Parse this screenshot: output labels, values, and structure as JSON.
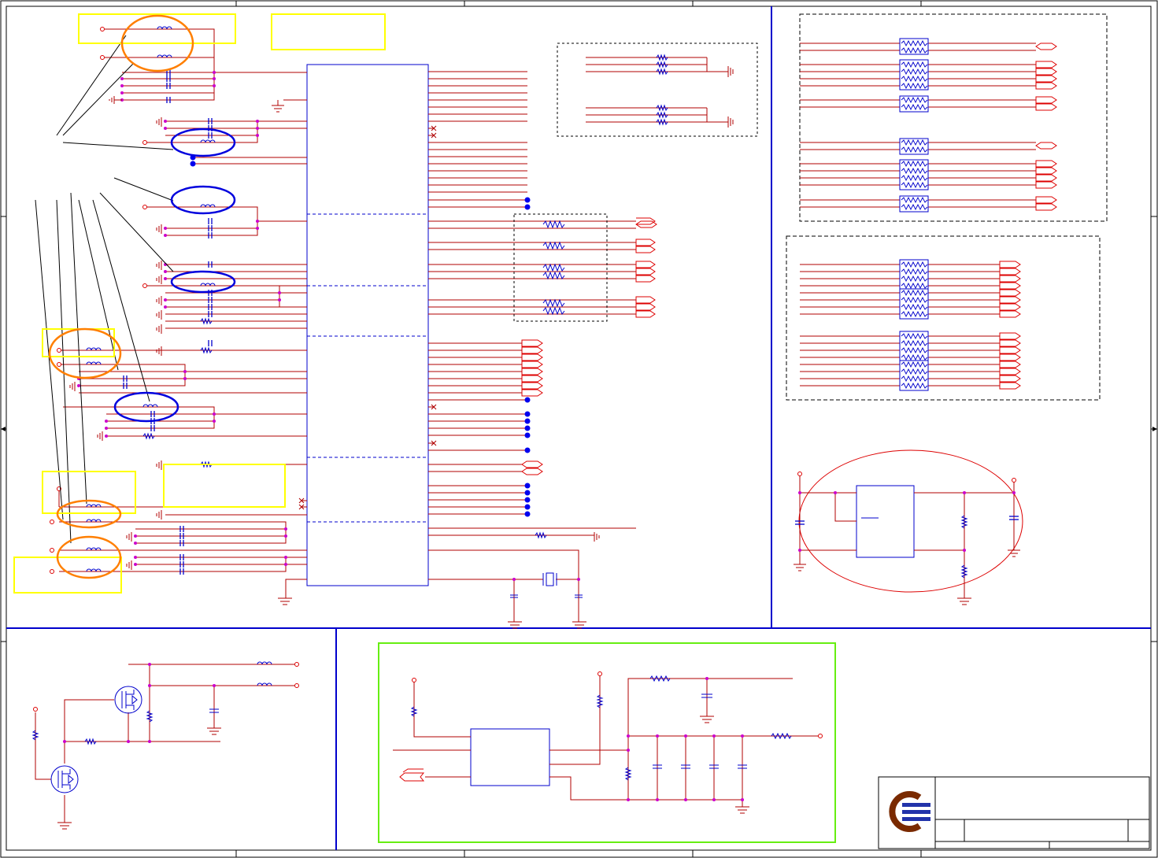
{
  "sheet": {
    "frame_color": "#000000",
    "region_border_color": "#0000cc",
    "wire_color": "#b00000",
    "component_color": "#0000cc",
    "junction_color": "#cc00cc",
    "highlight_yellow": "#ffff00",
    "highlight_orange": "#ff7f00",
    "highlight_green": "#66ee11",
    "highlight_blue": "#0000dd",
    "region_ellipse_color": "#dd0000"
  },
  "title_block": {
    "logo_name": "company-logo",
    "logo_primary_color": "#7a2a00",
    "logo_accent_color": "#2233aa"
  }
}
